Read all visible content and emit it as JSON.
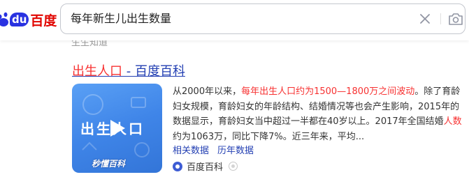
{
  "logo": {
    "du_text": "du",
    "brand_text": "百度"
  },
  "search": {
    "query": "每年新生儿出生数量"
  },
  "previous_result": {
    "cut_text": "生生知道"
  },
  "result": {
    "title_highlight": "出生人口",
    "title_rest": " - 百度百科",
    "thumbnail": {
      "overlay_text": "出生人口",
      "brand_text": "秒懂百科"
    },
    "abstract": {
      "part1": "从2000年以来，",
      "highlight1": "每年出生人口约为1500—1800万之间波动",
      "part2": "。除了育龄妇女规模，育龄妇女的年龄结构、结婚情况等也会产生影响，2015年的数据显示，育龄妇女当中超过一半都在40岁以上。2017年全国结婚",
      "highlight2": "人数",
      "part3": "约为1063万，同比下降7%。近三年来，平均..."
    },
    "links": {
      "related_data": "相关数据",
      "historical_data": "历年数据"
    },
    "source": {
      "name": "百度百科"
    }
  },
  "colors": {
    "link_blue": "#2440b3",
    "highlight_red": "#f73131",
    "brand_blue": "#2932e1",
    "brand_red": "#e10601"
  },
  "icons": {
    "clear": "close-icon",
    "camera": "camera-icon",
    "play": "play-icon"
  }
}
